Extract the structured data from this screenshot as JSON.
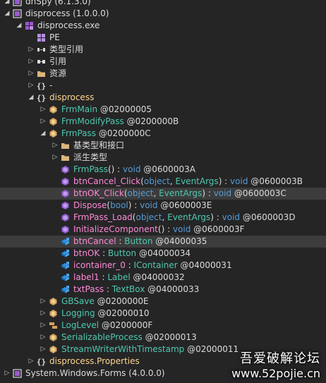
{
  "colors": {
    "background": "#252526",
    "selected_row": "#3c3c3c",
    "class_text": "#4ec9b0",
    "method_text": "#ff8ad8",
    "namespace_icon": "#dcdcdc",
    "keyword_text": "#569cd6",
    "assembly_icon": "#9b59d0"
  },
  "tree": {
    "rows": [
      {
        "indent": 0,
        "chevron": "expanded",
        "icon": "assembly-icon",
        "parts": [
          {
            "t": "dnSpy (6.1.3.0)",
            "c": "white"
          }
        ],
        "selected": false
      },
      {
        "indent": 0,
        "chevron": "expanded",
        "icon": "assembly-icon",
        "parts": [
          {
            "t": "disprocess (1.0.0.0)",
            "c": "white"
          }
        ],
        "selected": false
      },
      {
        "indent": 1,
        "chevron": "expanded",
        "icon": "module-icon",
        "parts": [
          {
            "t": "disprocess.exe",
            "c": "white"
          }
        ],
        "selected": false
      },
      {
        "indent": 2,
        "chevron": "none",
        "icon": "pe-icon",
        "parts": [
          {
            "t": "PE",
            "c": "white"
          }
        ],
        "selected": false
      },
      {
        "indent": 2,
        "chevron": "collapsed",
        "icon": "typeref-icon",
        "parts": [
          {
            "t": "类型引用",
            "c": "white"
          }
        ],
        "selected": false
      },
      {
        "indent": 2,
        "chevron": "collapsed",
        "icon": "reference-icon",
        "parts": [
          {
            "t": "引用",
            "c": "white"
          }
        ],
        "selected": false
      },
      {
        "indent": 2,
        "chevron": "collapsed",
        "icon": "folder-icon",
        "parts": [
          {
            "t": "资源",
            "c": "white"
          }
        ],
        "selected": false
      },
      {
        "indent": 2,
        "chevron": "collapsed",
        "icon": "namespace-icon",
        "parts": [
          {
            "t": "-",
            "c": "white"
          }
        ],
        "selected": false
      },
      {
        "indent": 2,
        "chevron": "expanded",
        "icon": "namespace-icon",
        "parts": [
          {
            "t": "disprocess",
            "c": "ns"
          }
        ],
        "selected": false
      },
      {
        "indent": 3,
        "chevron": "collapsed",
        "icon": "class-icon",
        "parts": [
          {
            "t": "FrmMain",
            "c": "class"
          },
          {
            "t": " @02000005",
            "c": "id"
          }
        ],
        "selected": false
      },
      {
        "indent": 3,
        "chevron": "collapsed",
        "icon": "class-icon",
        "parts": [
          {
            "t": "FrmModifyPass",
            "c": "class"
          },
          {
            "t": " @0200000B",
            "c": "id"
          }
        ],
        "selected": false
      },
      {
        "indent": 3,
        "chevron": "expanded",
        "icon": "class-icon",
        "parts": [
          {
            "t": "FrmPass",
            "c": "class"
          },
          {
            "t": " @0200000C",
            "c": "id"
          }
        ],
        "selected": false
      },
      {
        "indent": 4,
        "chevron": "collapsed",
        "icon": "folder-icon",
        "parts": [
          {
            "t": "基类型和接口",
            "c": "white"
          }
        ],
        "selected": false
      },
      {
        "indent": 4,
        "chevron": "collapsed",
        "icon": "folder-icon",
        "parts": [
          {
            "t": "派生类型",
            "c": "white"
          }
        ],
        "selected": false
      },
      {
        "indent": 4,
        "chevron": "none",
        "icon": "method-icon",
        "parts": [
          {
            "t": "FrmPass",
            "c": "class"
          },
          {
            "t": "() : ",
            "c": "white"
          },
          {
            "t": "void",
            "c": "kw"
          },
          {
            "t": " @0600003A",
            "c": "id"
          }
        ],
        "selected": false
      },
      {
        "indent": 4,
        "chevron": "none",
        "icon": "method-icon",
        "parts": [
          {
            "t": "btnCancel_Click",
            "c": "method"
          },
          {
            "t": "(",
            "c": "white"
          },
          {
            "t": "object",
            "c": "kw"
          },
          {
            "t": ", ",
            "c": "white"
          },
          {
            "t": "EventArgs",
            "c": "class"
          },
          {
            "t": ") : ",
            "c": "white"
          },
          {
            "t": "void",
            "c": "kw"
          },
          {
            "t": " @0600003B",
            "c": "id"
          }
        ],
        "selected": false
      },
      {
        "indent": 4,
        "chevron": "none",
        "icon": "method-icon",
        "parts": [
          {
            "t": "btnOK_Click",
            "c": "method"
          },
          {
            "t": "(",
            "c": "white"
          },
          {
            "t": "object",
            "c": "kw"
          },
          {
            "t": ", ",
            "c": "white"
          },
          {
            "t": "EventArgs",
            "c": "class"
          },
          {
            "t": ") : ",
            "c": "white"
          },
          {
            "t": "void",
            "c": "kw"
          },
          {
            "t": " @0600003C",
            "c": "id"
          }
        ],
        "selected": true
      },
      {
        "indent": 4,
        "chevron": "none",
        "icon": "method-icon",
        "parts": [
          {
            "t": "Dispose",
            "c": "method"
          },
          {
            "t": "(",
            "c": "white"
          },
          {
            "t": "bool",
            "c": "kw"
          },
          {
            "t": ") : ",
            "c": "white"
          },
          {
            "t": "void",
            "c": "kw"
          },
          {
            "t": " @0600003E",
            "c": "id"
          }
        ],
        "selected": false
      },
      {
        "indent": 4,
        "chevron": "none",
        "icon": "method-icon",
        "parts": [
          {
            "t": "FrmPass_Load",
            "c": "method"
          },
          {
            "t": "(",
            "c": "white"
          },
          {
            "t": "object",
            "c": "kw"
          },
          {
            "t": ", ",
            "c": "white"
          },
          {
            "t": "EventArgs",
            "c": "class"
          },
          {
            "t": ") : ",
            "c": "white"
          },
          {
            "t": "void",
            "c": "kw"
          },
          {
            "t": " @0600003D",
            "c": "id"
          }
        ],
        "selected": false
      },
      {
        "indent": 4,
        "chevron": "none",
        "icon": "method-icon",
        "parts": [
          {
            "t": "InitializeComponent",
            "c": "method"
          },
          {
            "t": "() : ",
            "c": "white"
          },
          {
            "t": "void",
            "c": "kw"
          },
          {
            "t": " @0600003F",
            "c": "id"
          }
        ],
        "selected": false
      },
      {
        "indent": 4,
        "chevron": "none",
        "icon": "field-icon",
        "parts": [
          {
            "t": "btnCancel",
            "c": "method"
          },
          {
            "t": " : ",
            "c": "white"
          },
          {
            "t": "Button",
            "c": "class"
          },
          {
            "t": " @04000035",
            "c": "id"
          }
        ],
        "selected": true
      },
      {
        "indent": 4,
        "chevron": "none",
        "icon": "field-icon",
        "parts": [
          {
            "t": "btnOK",
            "c": "method"
          },
          {
            "t": " : ",
            "c": "white"
          },
          {
            "t": "Button",
            "c": "class"
          },
          {
            "t": " @04000034",
            "c": "id"
          }
        ],
        "selected": false
      },
      {
        "indent": 4,
        "chevron": "none",
        "icon": "field-icon",
        "parts": [
          {
            "t": "icontainer_0",
            "c": "method"
          },
          {
            "t": " : ",
            "c": "white"
          },
          {
            "t": "IContainer",
            "c": "class"
          },
          {
            "t": " @04000031",
            "c": "id"
          }
        ],
        "selected": false
      },
      {
        "indent": 4,
        "chevron": "none",
        "icon": "field-icon",
        "parts": [
          {
            "t": "label1",
            "c": "method"
          },
          {
            "t": " : ",
            "c": "white"
          },
          {
            "t": "Label",
            "c": "class"
          },
          {
            "t": " @04000032",
            "c": "id"
          }
        ],
        "selected": false
      },
      {
        "indent": 4,
        "chevron": "none",
        "icon": "field-icon",
        "parts": [
          {
            "t": "txtPass",
            "c": "method"
          },
          {
            "t": " : ",
            "c": "white"
          },
          {
            "t": "TextBox",
            "c": "class"
          },
          {
            "t": " @04000033",
            "c": "id"
          }
        ],
        "selected": false
      },
      {
        "indent": 3,
        "chevron": "collapsed",
        "icon": "class-icon",
        "parts": [
          {
            "t": "GBSave",
            "c": "class"
          },
          {
            "t": " @0200000E",
            "c": "id"
          }
        ],
        "selected": false
      },
      {
        "indent": 3,
        "chevron": "collapsed",
        "icon": "class-icon",
        "parts": [
          {
            "t": "Logging",
            "c": "class"
          },
          {
            "t": " @02000010",
            "c": "id"
          }
        ],
        "selected": false
      },
      {
        "indent": 3,
        "chevron": "collapsed",
        "icon": "enum-icon",
        "parts": [
          {
            "t": "LogLevel",
            "c": "class"
          },
          {
            "t": " @0200000F",
            "c": "id"
          }
        ],
        "selected": false
      },
      {
        "indent": 3,
        "chevron": "collapsed",
        "icon": "class-icon",
        "parts": [
          {
            "t": "SerializableProcess",
            "c": "class"
          },
          {
            "t": " @02000013",
            "c": "id"
          }
        ],
        "selected": false
      },
      {
        "indent": 3,
        "chevron": "collapsed",
        "icon": "class-icon",
        "parts": [
          {
            "t": "StreamWriterWithTimestamp",
            "c": "class"
          },
          {
            "t": " @02000011",
            "c": "id"
          }
        ],
        "selected": false
      },
      {
        "indent": 2,
        "chevron": "collapsed",
        "icon": "namespace-icon",
        "parts": [
          {
            "t": "disprocess.Properties",
            "c": "ns"
          }
        ],
        "selected": false
      },
      {
        "indent": 0,
        "chevron": "collapsed",
        "icon": "assembly-icon",
        "parts": [
          {
            "t": "System.Windows.Forms (4.0.0.0)",
            "c": "white"
          }
        ],
        "selected": false
      }
    ]
  },
  "watermark": {
    "line1": "吾爱破解论坛",
    "line2": "www.52pojie.cn"
  }
}
